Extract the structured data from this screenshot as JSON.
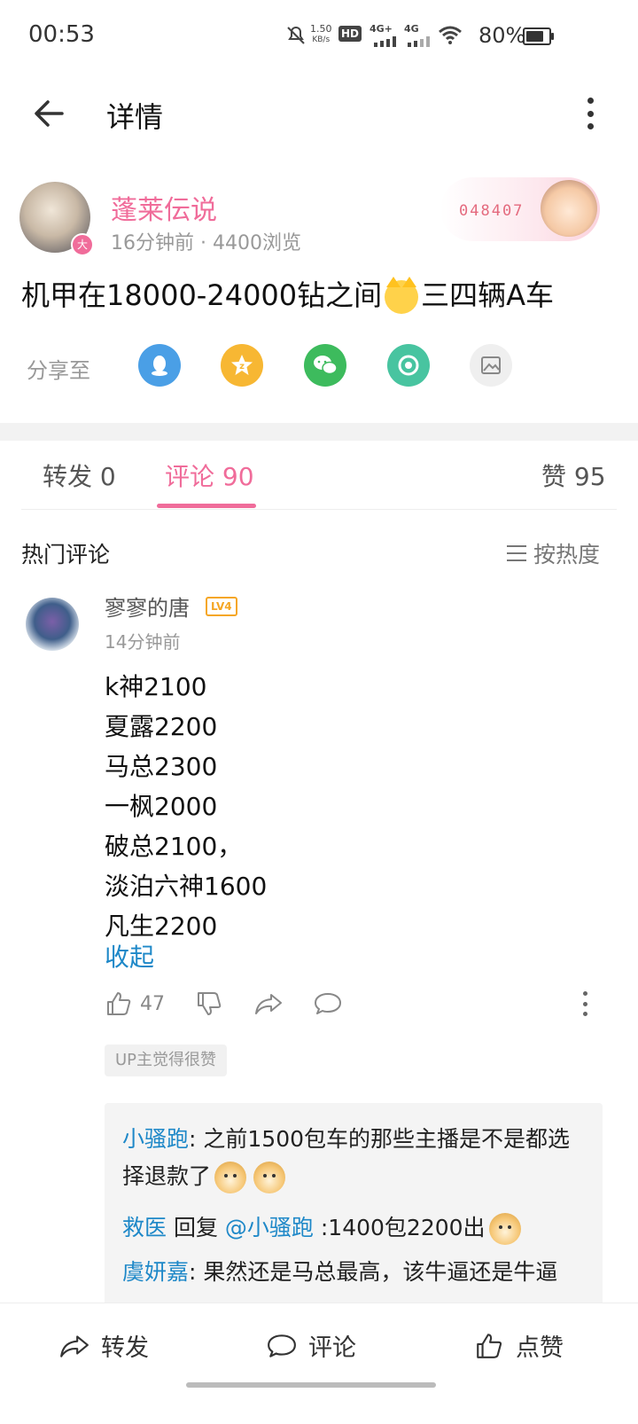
{
  "status_bar": {
    "time": "00:53",
    "net_speed_value": "1.50",
    "net_speed_unit": "KB/s",
    "hd_label": "HD",
    "sig1_label": "4G+",
    "sig2_label": "4G",
    "battery_text": "80%",
    "battery_level": 0.8
  },
  "header": {
    "title": "详情"
  },
  "post": {
    "author": "蓬莱伝说",
    "avatar_badge": "大",
    "meta": "16分钟前 · 4400浏览",
    "decor_number": "048407",
    "content_before": "机甲在18000-24000钻之间",
    "content_after": "三四辆A车"
  },
  "share": {
    "label": "分享至",
    "targets": [
      {
        "icon": "qq-icon",
        "color": "#4a9fe6"
      },
      {
        "icon": "qzone-icon",
        "color": "#f7b733"
      },
      {
        "icon": "wechat-icon",
        "color": "#3dbb5d"
      },
      {
        "icon": "moments-icon",
        "color": "#48c4a0"
      },
      {
        "icon": "image-icon",
        "color": "#efefef"
      }
    ]
  },
  "tabs": {
    "repost": "转发 0",
    "comments": "评论 90",
    "likes": "赞 95"
  },
  "hot_comments": {
    "title": "热门评论",
    "sort_label": "按热度"
  },
  "comment": {
    "name": "寥寥的唐",
    "level": "LV4",
    "time": "14分钟前",
    "lines": [
      "k神2100",
      "夏露2200",
      "马总2300",
      "一枫2000",
      "破总2100，",
      "淡泊六神1600",
      "凡生2200"
    ],
    "collapse": "收起",
    "like_count": "47",
    "up_tag": "UP主觉得很赞"
  },
  "replies": [
    {
      "name": "小骚跑",
      "text": ": 之前1500包车的那些主播是不是都选择退款了"
    },
    {
      "name": "救医",
      "reply_word": " 回复 ",
      "mention": "@小骚跑",
      "text": " :1400包2200出"
    },
    {
      "name": "虞妍嘉",
      "text": ": 果然还是马总最高，该牛逼还是牛逼"
    }
  ],
  "bottom_bar": {
    "repost": "转发",
    "comment": "评论",
    "like": "点赞"
  },
  "colors": {
    "accent_pink": "#f06c9a",
    "link_blue": "#1e88c8"
  }
}
